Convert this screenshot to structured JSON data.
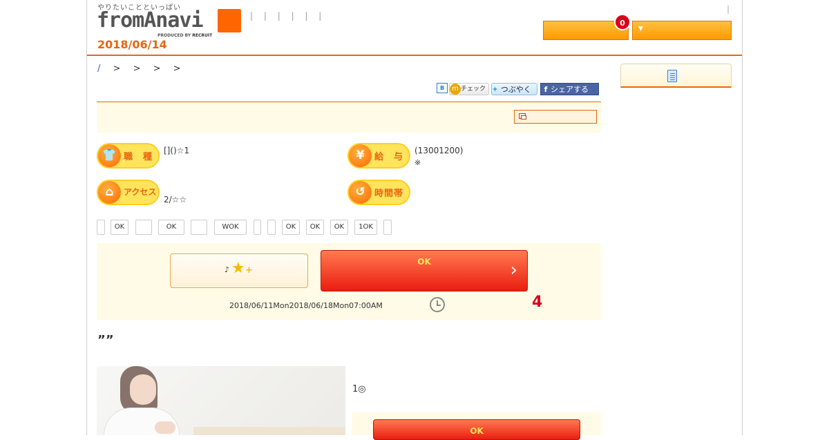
{
  "header": {
    "tagline": "やりたいことといっぱい",
    "logo": "fromAnavi",
    "produced_by": "PRODUCED BY",
    "produced_brand": "RECRUIT",
    "nav": "| | | | | |",
    "date": "2018/06/14",
    "pipe": "|",
    "favorites_count": "0",
    "menu_arrow": "▼"
  },
  "breadcrumb": {
    "home": "/",
    "separators": [
      ">",
      ">",
      ">",
      ">"
    ]
  },
  "social": {
    "hatena": "B",
    "mixi_label": "チェック",
    "twitter_label": "つぶやく",
    "facebook_label": "シェアする"
  },
  "info": {
    "job_label": "職　種",
    "job_value": "[]()☆1",
    "salary_label": "給　与",
    "salary_value": "(13001200)",
    "salary_note": "※",
    "access_label": "アクセス",
    "access_value": "2/☆☆",
    "time_label": "時間帯",
    "icons": {
      "job": "shirt-icon",
      "salary": "yen-icon",
      "access": "train-icon",
      "time": "clock-arrow-icon"
    }
  },
  "tags": [
    "",
    "OK",
    "",
    "OK",
    "",
    "WOK",
    "",
    "",
    "OK",
    "OK",
    "OK",
    "1OK",
    ""
  ],
  "actions": {
    "keep_note": "♪",
    "keep_star": "★",
    "keep_plus": "+",
    "apply_label": "OK",
    "apply_chevron": "›",
    "period": "2018/06/11Mon2018/06/18Mon07:00AM",
    "days_left": "4"
  },
  "body": {
    "catch": "””",
    "description": "1◎",
    "apply_label_2": "OK"
  },
  "colors": {
    "brand_orange": "#e8650f",
    "apply_red": "#ea1d10",
    "badge_red": "#d9001b",
    "cream": "#fffbe6"
  }
}
